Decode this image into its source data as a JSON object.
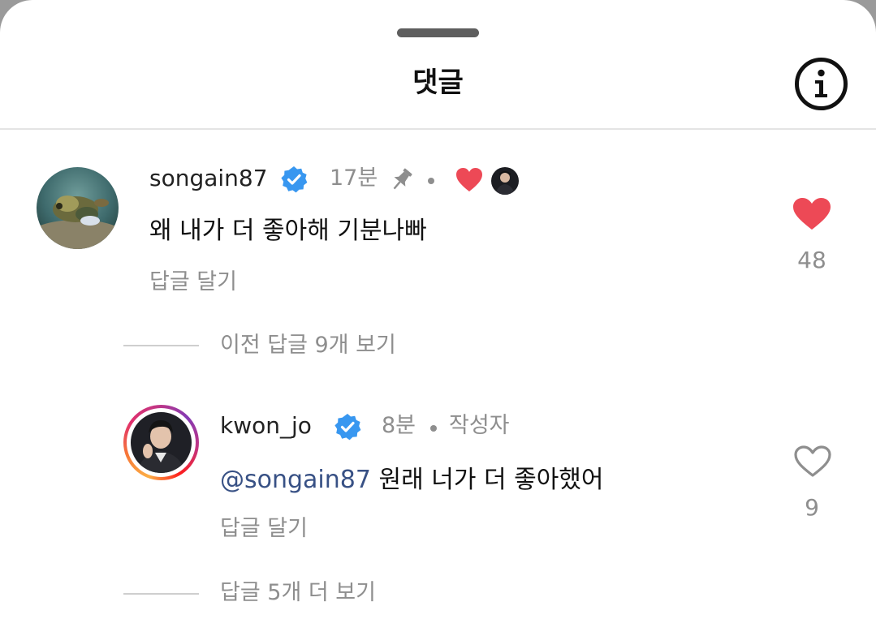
{
  "sheet": {
    "title": "댓글"
  },
  "comments": [
    {
      "username": "songain87",
      "verified": true,
      "time": "17분",
      "pinned": true,
      "text": "왜 내가 더 좋아해 기분나빠",
      "reply_label": "답글 달기",
      "likes": "48",
      "liked": true,
      "liked_by_creator": true,
      "avatar_icon": "fish-photo-avatar"
    },
    {
      "username": "kwon_jo",
      "verified": true,
      "time": "8분",
      "author_badge": "작성자",
      "mention": "@songain87",
      "text": " 원래 너가 더 좋아했어",
      "reply_label": "답글 달기",
      "likes": "9",
      "liked": false,
      "has_story_ring": true,
      "avatar_icon": "person-photo-avatar"
    }
  ],
  "threads": {
    "previous_replies": "이전 답글 9개 보기",
    "more_replies": "답글 5개 더 보기"
  },
  "colors": {
    "heart_red": "#ed4956",
    "verified_blue": "#3897f0",
    "meta_gray": "#8e8e8e",
    "mention_blue": "#385185"
  }
}
